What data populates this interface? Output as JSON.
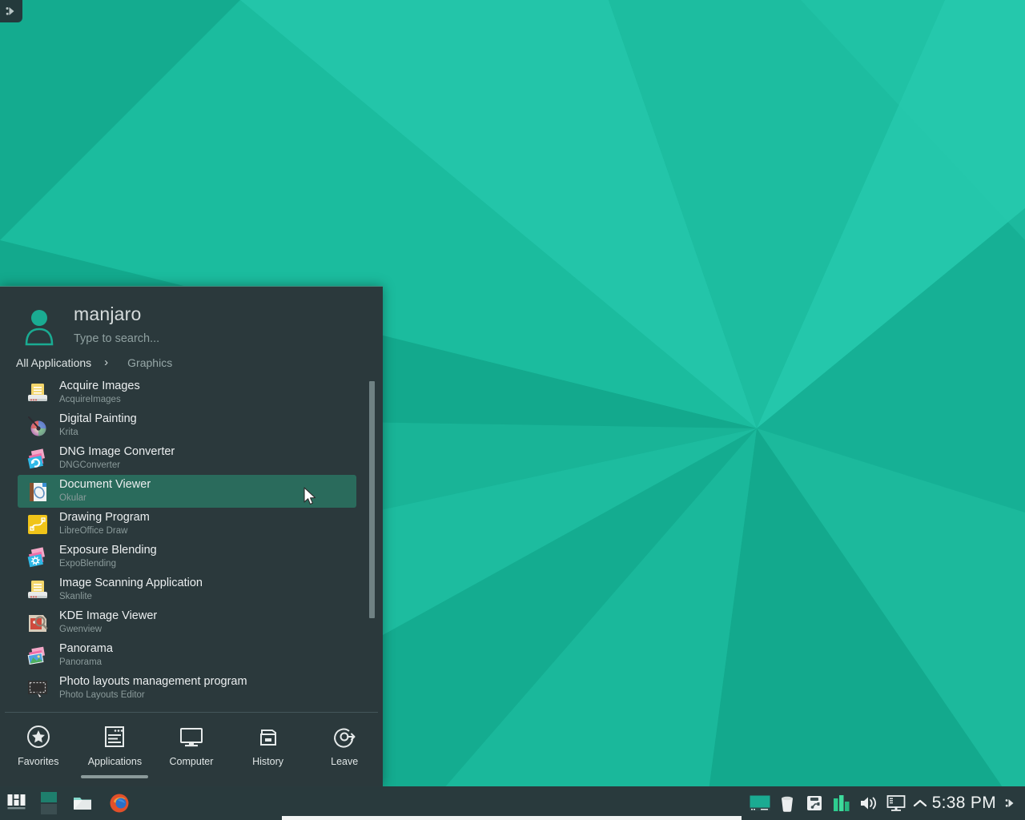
{
  "desktop": {
    "wallpaper_name": "manjaro-lowpoly-teal",
    "colors": {
      "base": "#17b395",
      "light": "#1fc0a3",
      "lighter": "#23c5a9",
      "dark": "#12a88c",
      "darker": "#0f9e84",
      "panel_bg": "#2b393c",
      "taskbar_bg": "#293a3d",
      "highlight": "#2a6b5c",
      "accent": "#3f8d7d",
      "text": "#eceff0",
      "text_dim": "#8b9b9b"
    },
    "toolbox_icon": "plasma-cashew-icon"
  },
  "launcher": {
    "user": {
      "name": "manjaro",
      "avatar_icon": "user-avatar-icon"
    },
    "search": {
      "placeholder": "Type to search...",
      "value": ""
    },
    "breadcrumb": {
      "root": "All Applications",
      "separator": "›",
      "current": "Graphics"
    },
    "apps": [
      {
        "name": "Acquire Images",
        "sub": "AcquireImages",
        "icon": "scanner-icon",
        "selected": false
      },
      {
        "name": "Digital Painting",
        "sub": "Krita",
        "icon": "krita-icon",
        "selected": false
      },
      {
        "name": "DNG Image Converter",
        "sub": "DNGConverter",
        "icon": "dng-converter-icon",
        "selected": false
      },
      {
        "name": "Document Viewer",
        "sub": "Okular",
        "icon": "okular-icon",
        "selected": true
      },
      {
        "name": "Drawing Program",
        "sub": "LibreOffice Draw",
        "icon": "libreoffice-draw-icon",
        "selected": false
      },
      {
        "name": "Exposure Blending",
        "sub": "ExpoBlending",
        "icon": "expoblending-icon",
        "selected": false
      },
      {
        "name": "Image Scanning Application",
        "sub": "Skanlite",
        "icon": "scanner-icon",
        "selected": false
      },
      {
        "name": "KDE Image Viewer",
        "sub": "Gwenview",
        "icon": "gwenview-icon",
        "selected": false
      },
      {
        "name": "Panorama",
        "sub": "Panorama",
        "icon": "panorama-icon",
        "selected": false
      },
      {
        "name": "Photo layouts management program",
        "sub": "Photo Layouts Editor",
        "icon": "photo-layouts-icon",
        "selected": false
      }
    ],
    "tabs": [
      {
        "label": "Favorites",
        "icon": "star-circle-icon",
        "active": false
      },
      {
        "label": "Applications",
        "icon": "applications-icon",
        "active": true
      },
      {
        "label": "Computer",
        "icon": "monitor-icon",
        "active": false
      },
      {
        "label": "History",
        "icon": "history-icon",
        "active": false
      },
      {
        "label": "Leave",
        "icon": "leave-icon",
        "active": false
      }
    ]
  },
  "taskbar": {
    "launcher": {
      "label": "Manjaro",
      "icon": "manjaro-logo-icon"
    },
    "pager": {
      "label": "Pager",
      "desktops": 2,
      "active_desktop": 1
    },
    "apps": [
      {
        "label": "File Manager",
        "icon": "folder-icon"
      },
      {
        "label": "Firefox",
        "icon": "firefox-icon"
      }
    ],
    "tray": [
      {
        "label": "Desktop Preview",
        "icon": "desktop-preview-icon"
      },
      {
        "label": "Trash",
        "icon": "trash-icon"
      },
      {
        "label": "Removable Devices",
        "icon": "usb-device-icon"
      },
      {
        "label": "System Monitor",
        "icon": "system-monitor-icon"
      },
      {
        "label": "Volume",
        "icon": "speaker-icon"
      },
      {
        "label": "Clipboard",
        "icon": "clipboard-display-icon"
      }
    ],
    "tray_expand_icon": "chevron-up-icon",
    "clock": {
      "time": "5:38 PM"
    },
    "cashew_icon": "plasma-cashew-icon"
  }
}
